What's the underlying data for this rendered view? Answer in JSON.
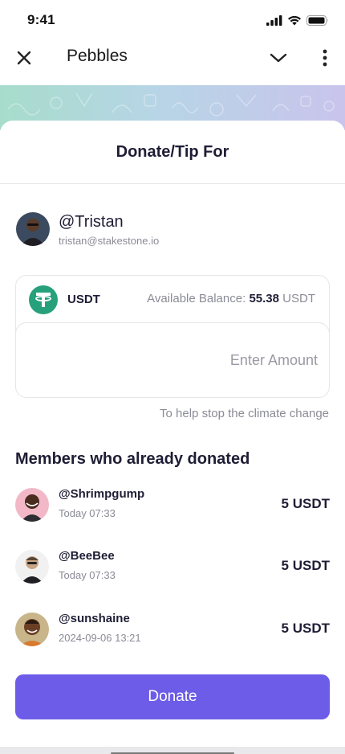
{
  "status_bar": {
    "time": "9:41",
    "icons": [
      "cellular-signal-icon",
      "wifi-icon",
      "battery-icon"
    ]
  },
  "top_bar": {
    "title": "Pebbles",
    "left_icon": "close-icon",
    "right_icons": [
      "chevron-down-icon",
      "more-vertical-icon"
    ]
  },
  "sheet": {
    "title": "Donate/Tip For"
  },
  "recipient": {
    "name": "@Tristan",
    "email": "tristan@stakestone.io"
  },
  "token": {
    "name": "USDT",
    "icon": "tether-icon",
    "balance_label": "Available Balance:",
    "balance_value": "55.38",
    "balance_unit": "USDT"
  },
  "amount_input": {
    "value": "",
    "placeholder": "Enter Amount"
  },
  "helper_text": "To help stop the climate change",
  "donors": {
    "title": "Members who already donated",
    "items": [
      {
        "name": "@Shrimpgump",
        "time": "Today 07:33",
        "amount": "5 USDT"
      },
      {
        "name": "@BeeBee",
        "time": "Today 07:33",
        "amount": "5 USDT"
      },
      {
        "name": "@sunshaine",
        "time": "2024-09-06 13:21",
        "amount": "5 USDT"
      }
    ]
  },
  "donate_button": {
    "label": "Donate"
  },
  "colors": {
    "accent": "#6c5ce7",
    "tether_green": "#26a17b",
    "text_primary": "#1f1d35",
    "text_secondary": "#8b8b97"
  }
}
